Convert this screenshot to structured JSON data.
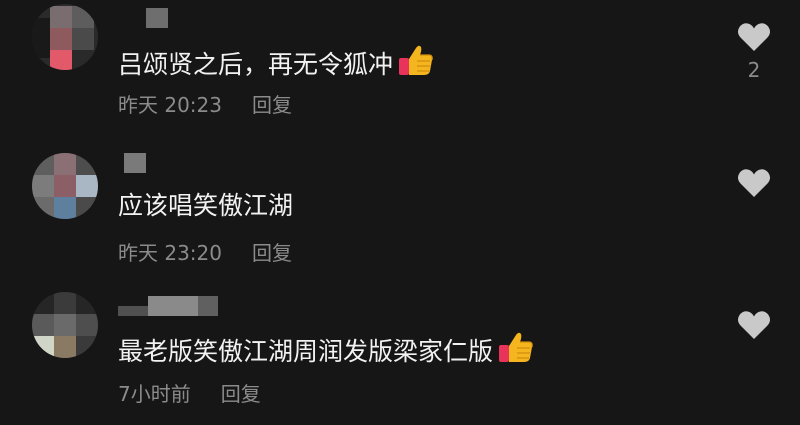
{
  "comments": [
    {
      "text": "吕颂贤之后，再无令狐冲",
      "emoji": "thumbs-up-icon",
      "time": "昨天 20:23",
      "reply_label": "回复",
      "like_count": "2"
    },
    {
      "text": "应该唱笑傲江湖",
      "time": "昨天 23:20",
      "reply_label": "回复",
      "like_count": ""
    },
    {
      "text": "最老版笑傲江湖周润发版梁家仁版",
      "emoji": "thumbs-up-icon",
      "time": "7小时前",
      "reply_label": "回复",
      "like_count": ""
    }
  ],
  "colors": {
    "background": "#161616",
    "text": "#f2f2f2",
    "secondary": "#8b8b8b",
    "heart": "#c9c9c9"
  }
}
